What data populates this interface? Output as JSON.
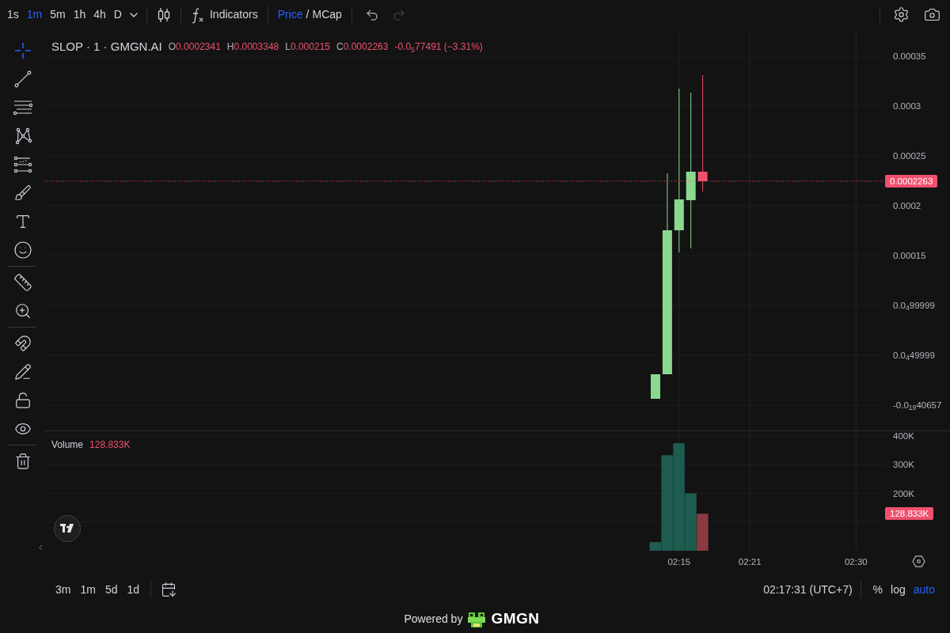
{
  "toolbar": {
    "intervals": [
      {
        "label": "1s",
        "selected": false
      },
      {
        "label": "1m",
        "selected": true
      },
      {
        "label": "5m",
        "selected": false
      },
      {
        "label": "1h",
        "selected": false
      },
      {
        "label": "4h",
        "selected": false
      },
      {
        "label": "D",
        "selected": false
      }
    ],
    "indicators": "Indicators",
    "price_mode": [
      {
        "label": "Price",
        "selected": true
      },
      {
        "label": "MCap",
        "selected": false
      }
    ],
    "price_mode_separator": "/",
    "redo_disabled": true
  },
  "drawing_tools": [
    {
      "tools": [
        {
          "kind": "crosshair",
          "selected": true
        },
        {
          "kind": "trend-line",
          "selected": false
        },
        {
          "kind": "fib",
          "selected": false
        },
        {
          "kind": "pattern",
          "selected": false
        },
        {
          "kind": "prediction",
          "selected": false
        },
        {
          "kind": "brush",
          "selected": false
        },
        {
          "kind": "text",
          "selected": false
        },
        {
          "kind": "emoji",
          "selected": false
        }
      ]
    },
    {
      "tools": [
        {
          "kind": "ruler",
          "selected": false
        },
        {
          "kind": "zoom",
          "selected": false
        }
      ]
    },
    {
      "tools": [
        {
          "kind": "magnet",
          "selected": false
        },
        {
          "kind": "lock-drawing",
          "selected": false
        },
        {
          "kind": "lock",
          "selected": false
        },
        {
          "kind": "eye",
          "selected": false
        }
      ]
    },
    {
      "tools": [
        {
          "kind": "trash",
          "selected": false
        }
      ]
    }
  ],
  "legend": {
    "title": "SLOP · 1 · GMGN.AI",
    "ohlc": [
      {
        "key": "O",
        "value": "0.0002341"
      },
      {
        "key": "H",
        "value": "0.0003348"
      },
      {
        "key": "L",
        "value": "0.000215"
      },
      {
        "key": "C",
        "value": "0.0002263"
      }
    ],
    "change": "-0.0$_{5}$77491 (−3.31%)"
  },
  "price_pane": {
    "last_price": "0.0002263",
    "axis_labels": [
      "0.00035",
      "0.0003",
      "0.00025",
      "0.0002",
      "0.00015",
      "0.0$_{4}$99999",
      "0.0$_{4}$49999",
      "-0.0$_{19}$40657"
    ]
  },
  "volume_pane": {
    "value": "128.833K",
    "last_volume": "128.833K",
    "chart_data": {
      "type": "bar",
      "grid": true,
      "categories": [
        null,
        null,
        "02:15",
        null,
        null,
        null,
        null,
        null,
        "02:21",
        null,
        null,
        null,
        null,
        null,
        null,
        null,
        null,
        "02:30",
        null,
        null
      ],
      "series": [
        {
          "name": "Volume",
          "values": [
            30000,
            333000,
            375000,
            200000,
            129000,
            null,
            null,
            null,
            null,
            null,
            null,
            null,
            null,
            null,
            null,
            null,
            null,
            null,
            null,
            null
          ]
        }
      ],
      "ylim": [
        0,
        416667
      ],
      "yticks": [
        {
          "value": 200000,
          "label": "200K"
        },
        {
          "value": 300000,
          "label": "300K"
        },
        {
          "value": 400000,
          "label": "400K"
        }
      ]
    }
  },
  "range_buttons": [
    "3m",
    "1m",
    "5d",
    "1d"
  ],
  "clock": "02:17:31 (UTC+7)",
  "scale_options": [
    {
      "label": "%",
      "selected": false
    },
    {
      "label": "log",
      "selected": false
    },
    {
      "label": "auto",
      "selected": true
    }
  ],
  "footer": {
    "powered_by": "Powered by",
    "brand": "GMGN"
  }
}
